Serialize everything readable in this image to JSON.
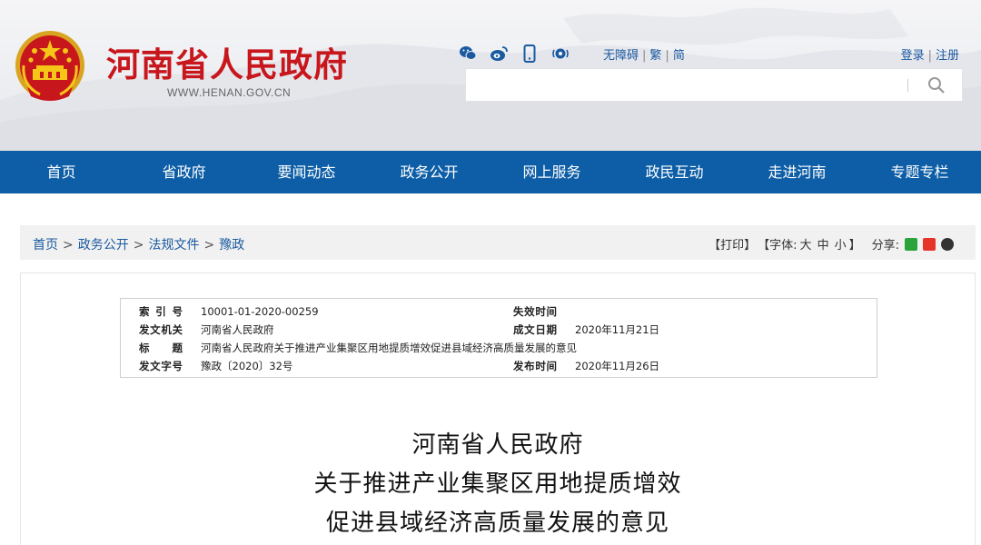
{
  "header": {
    "site_title": "河南省人民政府",
    "site_url": "WWW.HENAN.GOV.CN",
    "social_icons": [
      "wechat-icon",
      "weibo-icon",
      "mobile-icon",
      "broadcast-icon"
    ],
    "access_links": [
      "无障碍",
      "繁",
      "简"
    ],
    "login_links": [
      "登录",
      "注册"
    ],
    "search": {
      "value": "",
      "placeholder": ""
    },
    "colors": {
      "title_red": "#c8161d",
      "link_blue": "#1a5aa0"
    }
  },
  "nav": {
    "items": [
      "首页",
      "省政府",
      "要闻动态",
      "政务公开",
      "网上服务",
      "政民互动",
      "走进河南",
      "专题专栏"
    ],
    "background": "#0d5ea6"
  },
  "breadcrumb": {
    "items": [
      "首页",
      "政务公开",
      "法规文件",
      "豫政"
    ]
  },
  "tools": {
    "print": "【打印】",
    "font_label": "【字体:",
    "font_large": "大",
    "font_medium": "中",
    "font_small": "小",
    "font_close": "】",
    "share_label": "分享:",
    "share_icons": [
      "wechat-share-icon",
      "weibo-share-icon",
      "qq-share-icon"
    ]
  },
  "meta": {
    "rows": [
      {
        "label": "索引号",
        "value": "10001-01-2020-00259",
        "label2": "失效时间",
        "value2": ""
      },
      {
        "label": "发文机关",
        "value": "河南省人民政府",
        "label2": "成文日期",
        "value2": "2020年11月21日"
      },
      {
        "label": "标题",
        "value": "河南省人民政府关于推进产业集聚区用地提质增效促进县域经济高质量发展的意见",
        "label2": "",
        "value2": ""
      },
      {
        "label": "发文字号",
        "value": "豫政〔2020〕32号",
        "label2": "发布时间",
        "value2": "2020年11月26日"
      }
    ]
  },
  "document": {
    "title_lines": [
      "河南省人民政府",
      "关于推进产业集聚区用地提质增效",
      "促进县域经济高质量发展的意见"
    ]
  }
}
